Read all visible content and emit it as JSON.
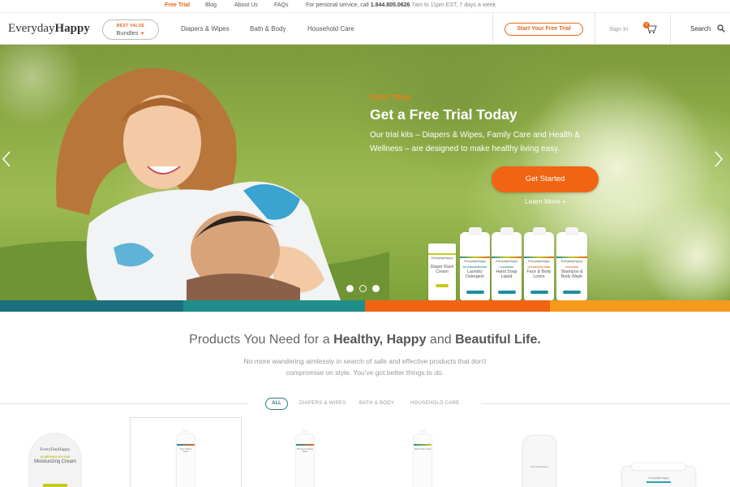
{
  "topbar": {
    "free_trial": "Free Trial",
    "blog": "Blog",
    "about": "About Us",
    "faqs": "FAQs",
    "phone_prefix": "For personal service, call ",
    "phone_number": "1.844.805.0626",
    "phone_hours": " 7am to 11pm EST, 7 days a week"
  },
  "header": {
    "logo_light": "Everyday",
    "logo_bold": "Happy",
    "bundles_badge": "BEST VALUE",
    "bundles_label": "Bundles",
    "nav": [
      "Diapers & Wipes",
      "Bath & Body",
      "Household Care"
    ],
    "trial_button": "Start Your Free Trial",
    "sign_in": "Sign In",
    "cart_count": "0",
    "search": "Search"
  },
  "hero": {
    "eyebrow": "FREE TRIAL",
    "title": "Get a Free Trial Today",
    "text": "Our trial kits – Diapers & Wipes, Family Care and Health & Wellness – are designed to make healthy living easy.",
    "cta": "Get Started",
    "learn_more": "Learn More +",
    "slide_count": 3,
    "active_slide": 2,
    "products": [
      {
        "brand": "EverydayHappy",
        "sub": "",
        "name": "Diaper Rash Cream",
        "color": "#c5cb1c"
      },
      {
        "brand": "EverydayHappy",
        "sub": "5X CONCENTRATED",
        "name": "Laundry Detergent",
        "color": "#1f8e9d"
      },
      {
        "brand": "EverydayHappy",
        "sub": "CLEANSING",
        "name": "Hand Soap Liquid",
        "color": "#1f8e9d"
      },
      {
        "brand": "EverydayHappy",
        "sub": "FRAGRANCE FREE",
        "name": "Face & Body Lotion",
        "color": "#e8671b"
      },
      {
        "brand": "EverydayHappy",
        "sub": "SOOTHING",
        "name": "Shampoo & Body Wash",
        "color": "#e8671b"
      }
    ]
  },
  "colors": {
    "accent": "#e8671b",
    "teal": "#2a7a86",
    "band": [
      "#1c6f7c",
      "#1f8e8a",
      "#f06414",
      "#f59a1d"
    ]
  },
  "section": {
    "title_pre": "Products You Need for a ",
    "title_b1": "Healthy, Happy",
    "title_mid": " and ",
    "title_b2": "Beautiful Life.",
    "subtitle": "No more wandering aimlessly in search of safe and effective products that don't compromise on style. You've got better things to do.",
    "filters": [
      "ALL",
      "DIAPERS & WIPES",
      "BATH & BODY",
      "HOUSEHOLD CARE"
    ],
    "active_filter": "ALL"
  },
  "grid": {
    "tin_brand": "EveryDayHappy",
    "tin_sub": "NOURISHING DRY SKIN",
    "tin_name": "Moisturizing Cream",
    "bottles": [
      "Face & Body Lotion",
      "Shampoo & Body Wash",
      "Hand Soap Liquid"
    ],
    "jug_label": "EverydayHappy",
    "wipes_label": "EverydayHappy"
  }
}
